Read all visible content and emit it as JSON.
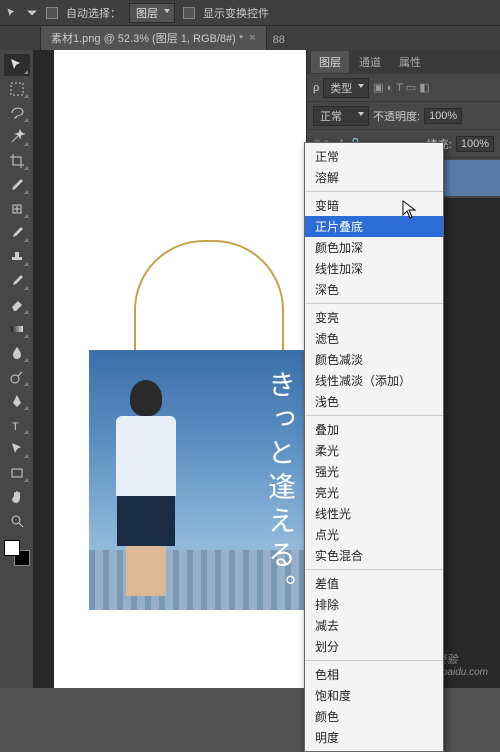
{
  "topbar": {
    "auto_select_label": "自动选择：",
    "target_dropdown": "图层",
    "show_transform_label": "显示变换控件"
  },
  "tabs": {
    "active": "素材1.png @ 52.3% (图层 1, RGB/8#) *",
    "active_close": "×",
    "second": "88"
  },
  "tools": [
    "move",
    "marquee",
    "lasso",
    "wand",
    "crop",
    "eyedropper",
    "heal",
    "brush",
    "stamp",
    "history-brush",
    "eraser",
    "gradient",
    "blur",
    "dodge",
    "pen",
    "type",
    "path-select",
    "rectangle",
    "hand",
    "zoom"
  ],
  "panel": {
    "tabs": {
      "layers": "图层",
      "channels": "通道",
      "paths": "属性"
    },
    "kind_label": "类型",
    "blend_mode": "正常",
    "opacity_label": "不透明度:",
    "opacity_value": "100%",
    "fill_label": "填充:",
    "fill_value": "100%"
  },
  "blend_modes": {
    "group1": [
      "正常",
      "溶解"
    ],
    "group2": [
      "变暗",
      "正片叠底",
      "颜色加深",
      "线性加深",
      "深色"
    ],
    "group3": [
      "变亮",
      "滤色",
      "颜色减淡",
      "线性减淡（添加）",
      "浅色"
    ],
    "group4": [
      "叠加",
      "柔光",
      "强光",
      "亮光",
      "线性光",
      "点光",
      "实色混合"
    ],
    "group5": [
      "差值",
      "排除",
      "减去",
      "划分"
    ],
    "group6": [
      "色相",
      "饱和度",
      "颜色",
      "明度"
    ],
    "selected": "正片叠底"
  },
  "canvas": {
    "japanese_text": "きっと逢える。"
  },
  "watermark": {
    "brand": "Baidu经验",
    "url": "jingyan.baidu.com"
  }
}
